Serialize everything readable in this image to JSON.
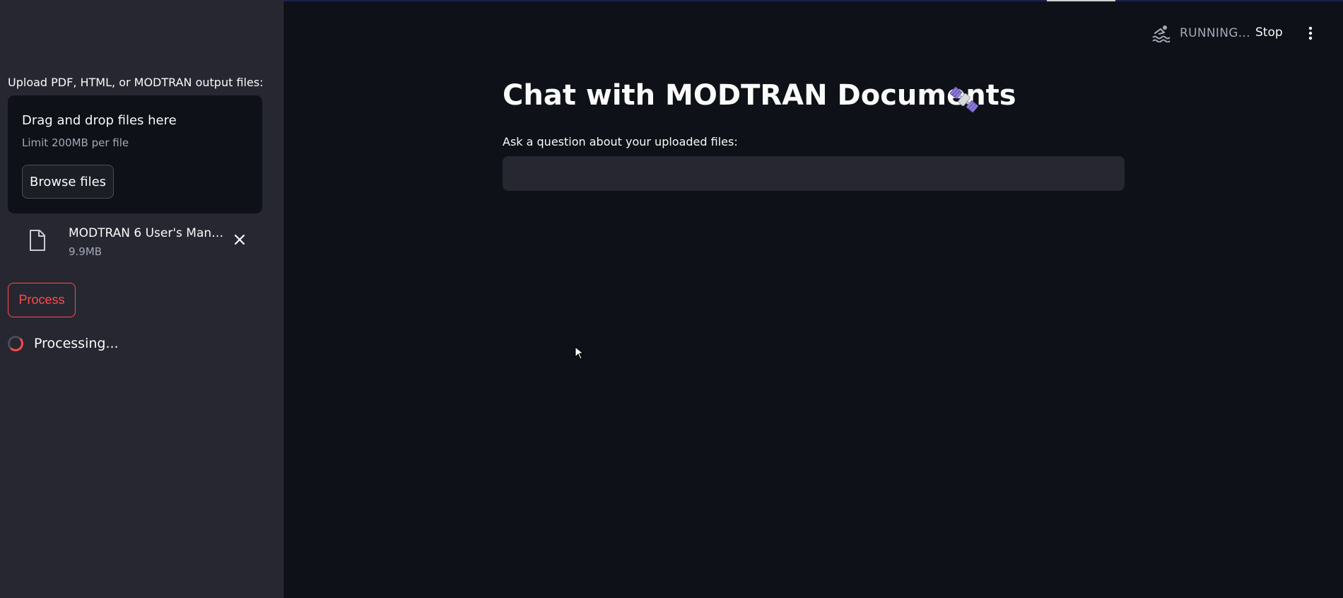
{
  "sidebar": {
    "upload_label": "Upload PDF, HTML, or MODTRAN output files:",
    "dropzone": {
      "title": "Drag and drop files here",
      "limit": "Limit 200MB per file",
      "browse_label": "Browse files"
    },
    "uploaded_file": {
      "name": "MODTRAN 6 User's Manu...",
      "size": "9.9MB",
      "icon": "file-icon"
    },
    "process_label": "Process",
    "processing_text": "Processing..."
  },
  "header": {
    "status_text": "RUNNING...",
    "stop_label": "Stop",
    "status_icon": "swimmer-icon",
    "menu_icon": "kebab-menu-icon"
  },
  "main": {
    "title": "Chat with MODTRAN Documents",
    "title_emoji": "satellite",
    "question_label": "Ask a question about your uploaded files:",
    "question_value": "",
    "question_placeholder": ""
  },
  "colors": {
    "background": "#0e1117",
    "sidebar": "#262730",
    "accent": "#ff4b4b",
    "muted_text": "#a3a8b8",
    "input_bg": "#262730"
  }
}
